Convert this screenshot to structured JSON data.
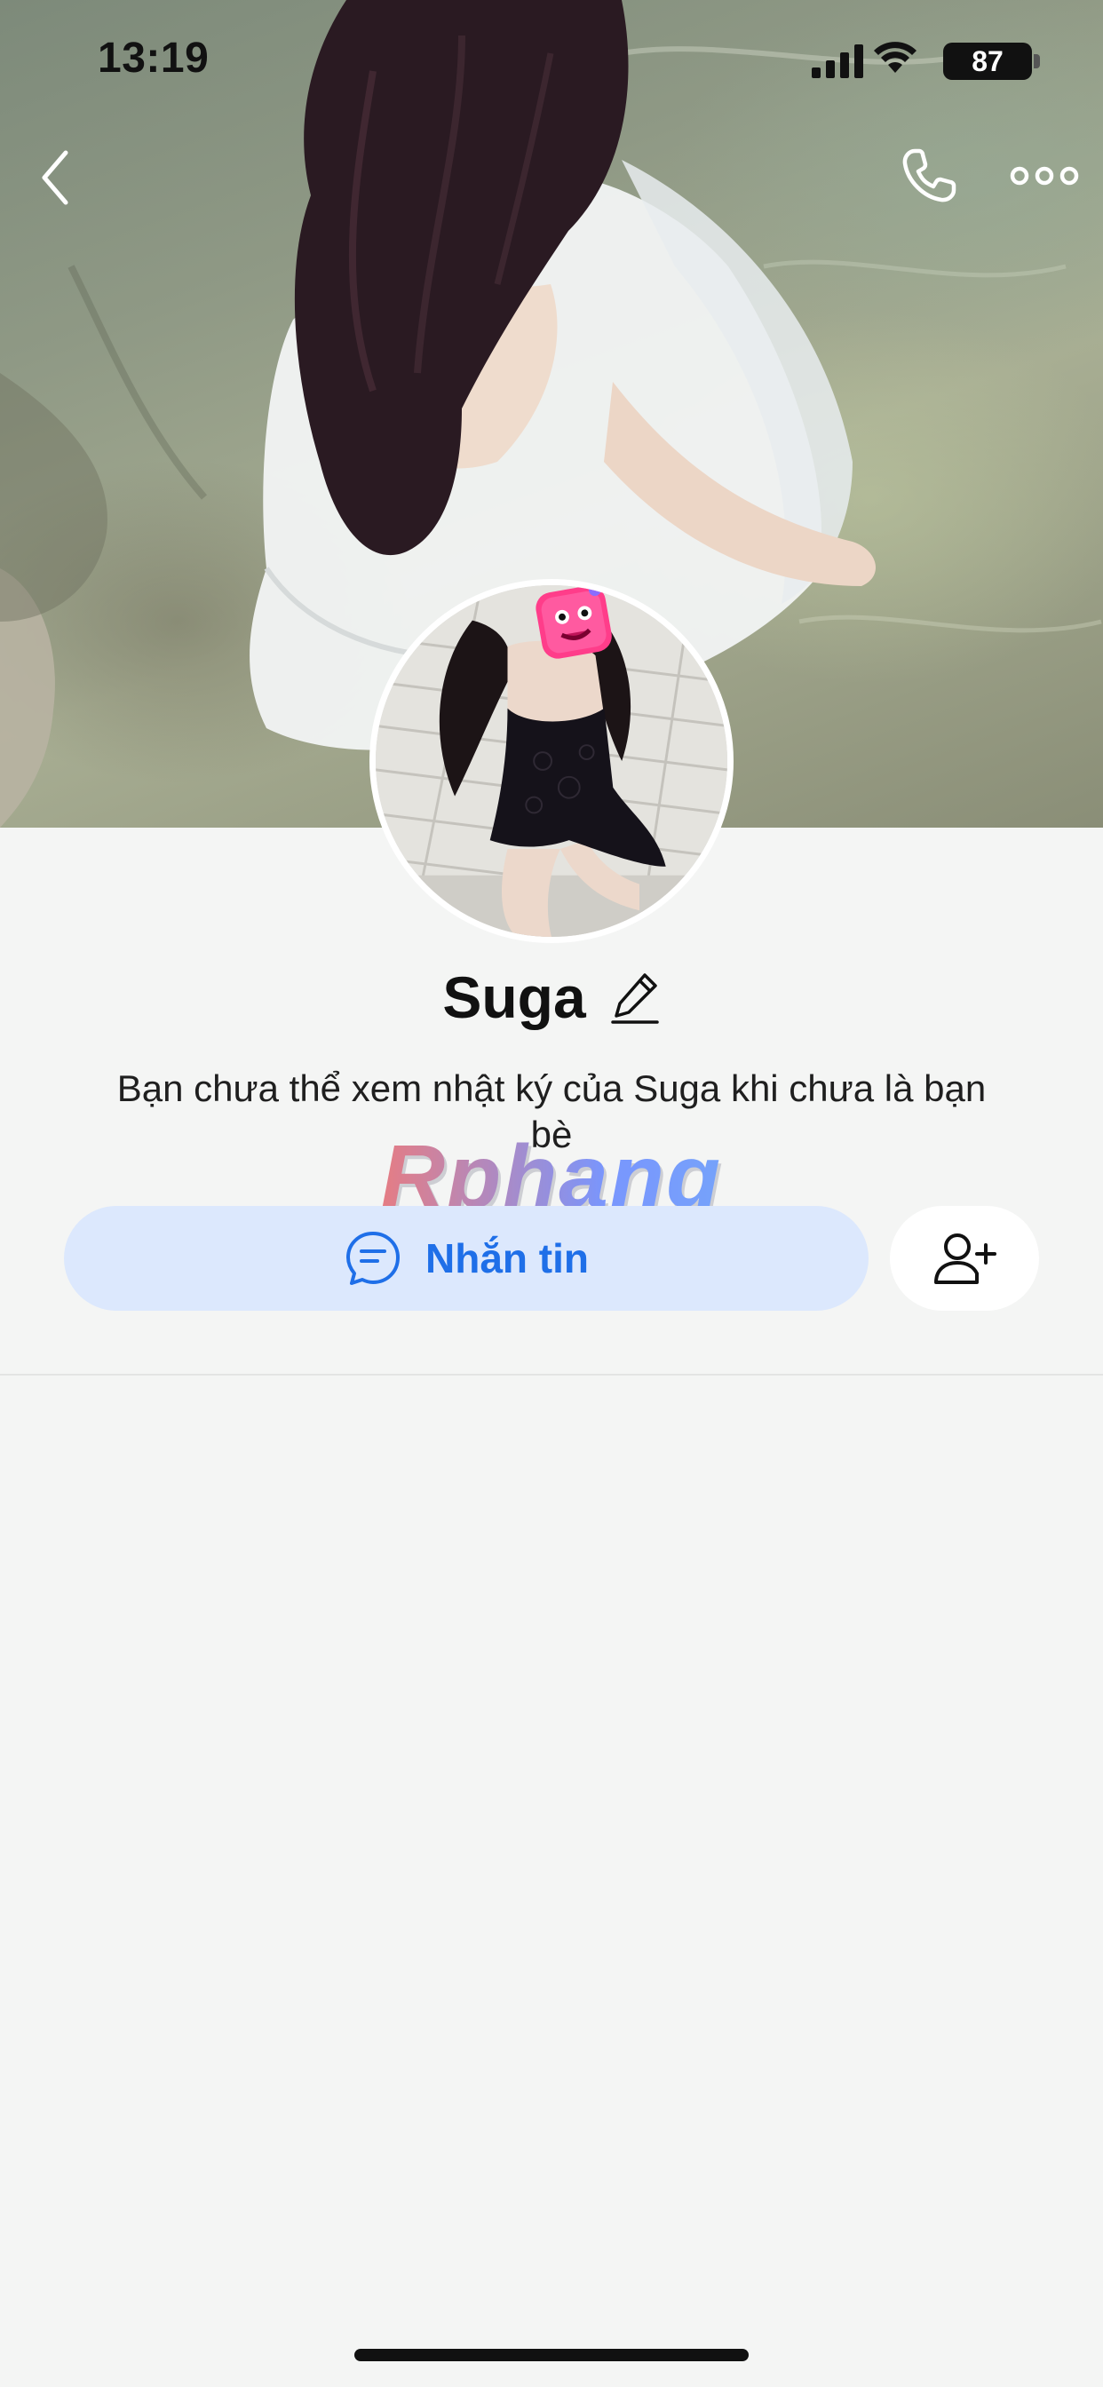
{
  "status_bar": {
    "time": "13:19",
    "battery_level": "87",
    "icons": [
      "signal-icon",
      "wifi-icon",
      "battery-icon"
    ]
  },
  "nav": {
    "icons": [
      "back-icon",
      "phone-icon",
      "more-icon"
    ]
  },
  "profile": {
    "name": "Suga",
    "description": "Bạn chưa thể xem nhật ký của Suga khi chưa là bạn bè"
  },
  "actions": {
    "message_label": "Nhắn tin",
    "message_icon": "chat-bubble-icon",
    "add_friend_icon": "add-friend-icon"
  },
  "watermark": {
    "text": "Rphang"
  },
  "colors": {
    "primary": "#1f6fe8",
    "message_button_bg": "#dce8fd",
    "background": "#f4f5f4"
  }
}
